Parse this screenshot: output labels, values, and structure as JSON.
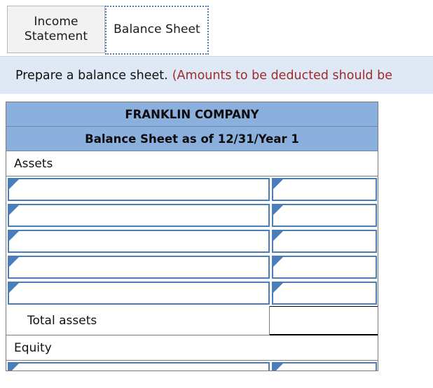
{
  "tabs": [
    {
      "id": "income-statement",
      "label": "Income Statement",
      "active": false
    },
    {
      "id": "balance-sheet",
      "label": "Balance Sheet",
      "active": true
    }
  ],
  "instruction": {
    "main": "Prepare a balance sheet.",
    "note": "(Amounts to be deducted should be"
  },
  "colors": {
    "header_blue": "#8bb0de",
    "banner_blue": "#dfe9f5",
    "note_red": "#9e2b2b",
    "input_border_blue": "#4a7ebb",
    "tab_inactive_gray": "#f2f2f2"
  },
  "sheet": {
    "company_title": "FRANKLIN COMPANY",
    "statement_title": "Balance Sheet as of 12/31/Year 1",
    "assets_section_label": "Assets",
    "asset_input_rows": [
      {
        "account": "",
        "amount": ""
      },
      {
        "account": "",
        "amount": ""
      },
      {
        "account": "",
        "amount": ""
      },
      {
        "account": "",
        "amount": ""
      },
      {
        "account": "",
        "amount": ""
      }
    ],
    "total_assets_label": "Total assets",
    "total_assets_value": "",
    "equity_section_label": "Equity",
    "equity_input_rows": [
      {
        "account": "",
        "amount": ""
      }
    ]
  },
  "icons": {
    "row_marker": "dropdown-arrow-marker"
  }
}
